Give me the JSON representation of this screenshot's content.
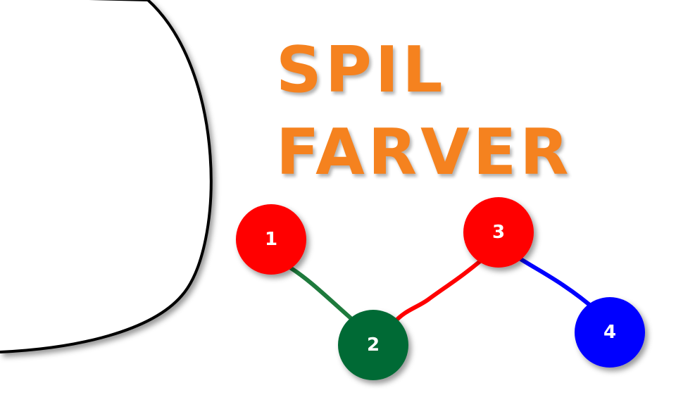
{
  "title": {
    "line1": "SPIL",
    "line2": "FARVER",
    "color": "#f5821f"
  },
  "graph": {
    "nodes": [
      {
        "label": "1",
        "color": "#ff0000"
      },
      {
        "label": "2",
        "color": "#006a35"
      },
      {
        "label": "3",
        "color": "#ff0000"
      },
      {
        "label": "4",
        "color": "#0000ff"
      }
    ],
    "edges": [
      {
        "from": "1",
        "to": "2",
        "color": "#1e7a3c"
      },
      {
        "from": "2",
        "to": "3",
        "color": "#ff0000"
      },
      {
        "from": "3",
        "to": "4",
        "color": "#0000ff"
      }
    ]
  },
  "colors": {
    "background": "#ffffff",
    "outline": "#000000"
  }
}
